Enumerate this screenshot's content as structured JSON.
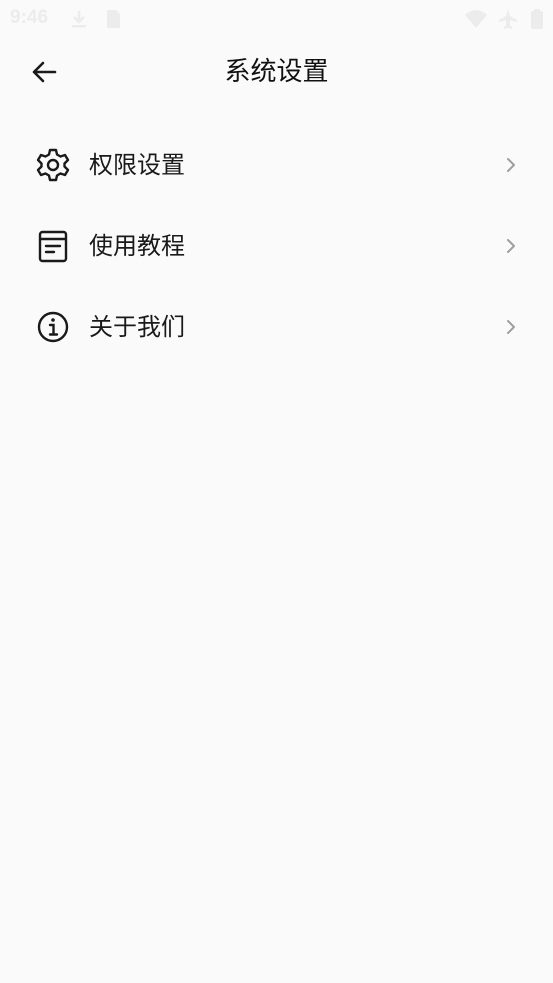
{
  "status_bar": {
    "time": "9:46"
  },
  "header": {
    "title": "系统设置"
  },
  "menu": {
    "items": [
      {
        "label": "权限设置",
        "icon": "gear-icon"
      },
      {
        "label": "使用教程",
        "icon": "document-icon"
      },
      {
        "label": "关于我们",
        "icon": "info-icon"
      }
    ]
  },
  "colors": {
    "background": "#fafafa",
    "text": "#1a1a1a",
    "chevron": "#9e9e9e",
    "status_icons": "#ececec"
  }
}
